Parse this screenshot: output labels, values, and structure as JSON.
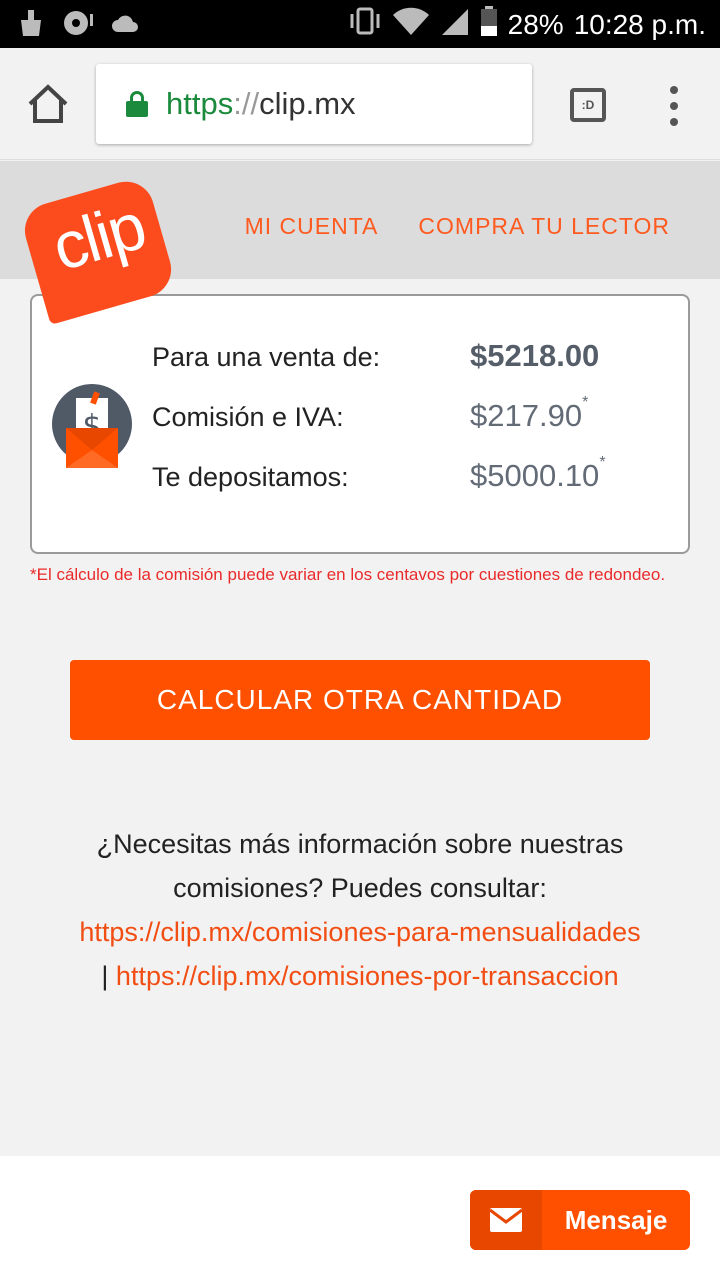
{
  "status_bar": {
    "battery": "28%",
    "time": "10:28 p.m.",
    "left_icons": [
      "cleaner-icon",
      "disc-icon",
      "cloud-icon"
    ],
    "right_icons": [
      "vibrate-icon",
      "wifi-icon",
      "signal-icon",
      "battery-icon"
    ]
  },
  "browser": {
    "url_scheme": "https",
    "url_separator": "://",
    "url_host": "clip.mx",
    "tabs_label": ":D"
  },
  "site": {
    "logo_text": "clip",
    "nav": [
      "MI CUENTA",
      "COMPRA TU LECTOR"
    ],
    "brand_color": "#ff5000"
  },
  "result": {
    "sale_label": "Para una venta de:",
    "sale_value": "$5218.00",
    "fee_label": "Comisión e IVA:",
    "fee_value": "$217.90",
    "fee_mark": "*",
    "deposit_label": "Te depositamos:",
    "deposit_value": "$5000.10",
    "deposit_mark": "*"
  },
  "note": "*El cálculo de la comisión puede variar en los centavos por cuestiones de redondeo.",
  "calc_button": "CALCULAR OTRA CANTIDAD",
  "info": {
    "text": "¿Necesitas más información sobre nuestras comisiones? Puedes consultar:",
    "link1": "https://clip.mx/comisiones-para-mensualidades",
    "separator": "|",
    "link2": "https://clip.mx/comisiones-por-transaccion"
  },
  "message_button": "Mensaje"
}
